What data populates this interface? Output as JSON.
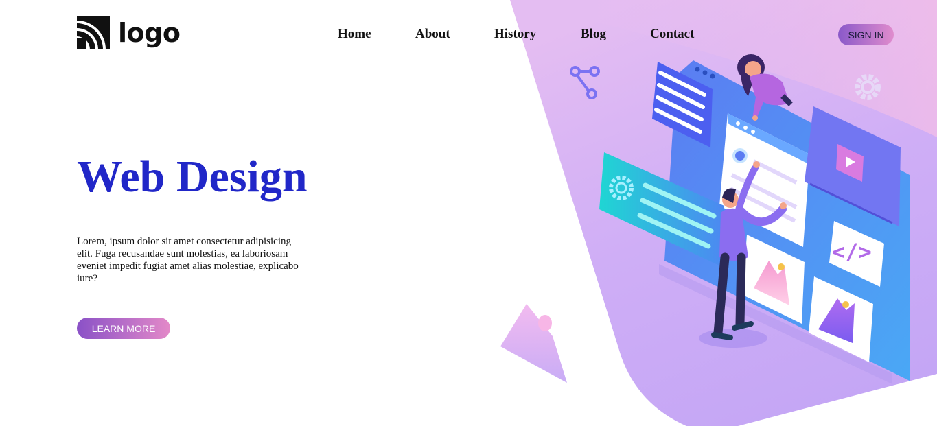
{
  "brand": {
    "logo_text": "logo"
  },
  "nav": {
    "items": [
      {
        "label": "Home"
      },
      {
        "label": "About"
      },
      {
        "label": "History"
      },
      {
        "label": "Blog"
      },
      {
        "label": "Contact"
      }
    ]
  },
  "header": {
    "signin_label": "SIGN IN"
  },
  "hero": {
    "title": "Web Design",
    "description": "Lorem, ipsum dolor sit amet consectetur adipisicing elit. Fuga recusandae sunt molestias, ea laboriosam eveniet impedit fugiat amet alias molestiae, explicabo iure?",
    "cta_label": "LEARN MORE"
  },
  "illustration": {
    "code_symbol": "</>"
  },
  "colors": {
    "title": "#2127c8",
    "gradient_start": "#8a51c7",
    "gradient_end": "#e389c8",
    "panel_blue": "#4f7ef0",
    "background_lavender": "#c9a8f3"
  },
  "icons": [
    "logo-mark-icon",
    "share-icon",
    "gear-icon",
    "code-icon",
    "image-icon",
    "play-icon"
  ]
}
